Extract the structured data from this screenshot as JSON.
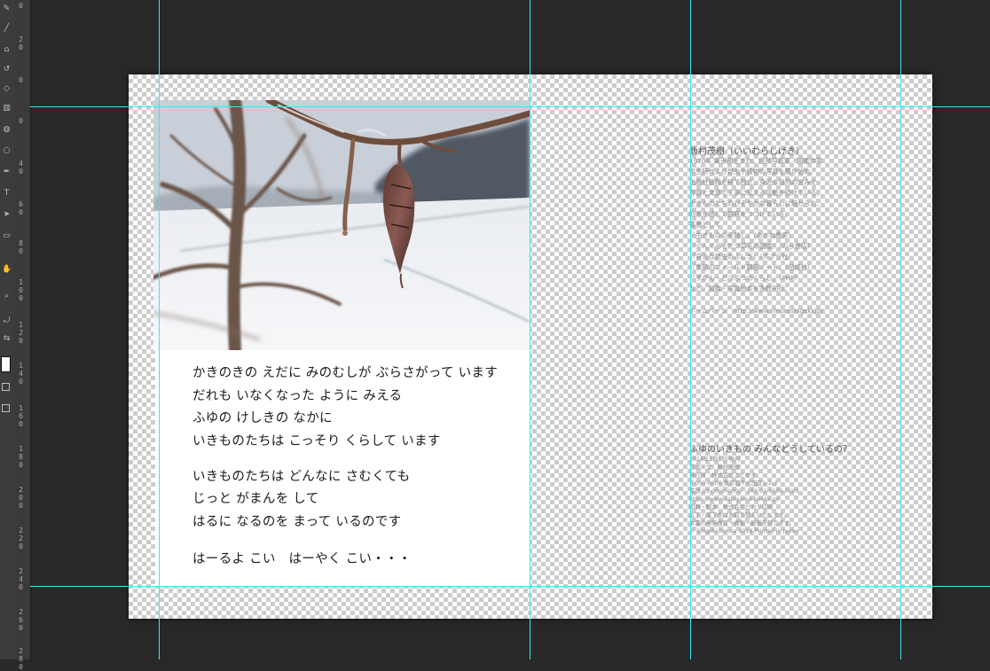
{
  "canvas": {
    "background": "#282828",
    "guide_color": "#3fe6f0"
  },
  "ruler": {
    "labels": [
      "0",
      "20",
      "0",
      "0",
      "40",
      "60",
      "80",
      "100",
      "120",
      "140",
      "160",
      "180",
      "200",
      "220",
      "240",
      "260",
      "280"
    ]
  },
  "poem": {
    "lines": [
      "かきのきの えだに みのむしが ぶらさがって います",
      "だれも いなくなった ように みえる",
      "ふゆの けしきの なかに",
      "いきものたちは こっそり くらして います",
      "いきものたちは どんなに さむくても",
      "じっと がまんを して",
      "はるに なるのを まって いるのです",
      "はーるよ こい　はーやく こい・・・"
    ]
  },
  "author": {
    "title": "飯村茂樹（いいむらしげき）",
    "lines": [
      "1970年 東京都生まれ。自然写真家／図鑑作家",
      "学生時代より昆虫や植物の写真を撮り始め、",
      "出版社勤務を経て独立。身近な自然の営みを",
      "写真と文章で丁寧に伝える活動を続けている。",
      "生きものたちのひそやかな暮らしに魅せられ、",
      "四季を通して観察をつづけている。",
      "著書として",
      "『生きものの冬越し』（あかね書房）",
      "『ぐんぐんそだつ草花の図鑑』（のら書店）",
      "『身近な昆虫のふしぎ』（ポプラ社）",
      "『季節のフィールド観察ノート』（偕成社）",
      "『ずかん・どうぶつのくらし』（PHP）",
      "など、図鑑・写真絵本を多数刊行。",
      "ホームページ　http://www.iimurashigeki.jp/"
    ]
  },
  "credits": {
    "title": "ふゆのいきもの みんなどうしているの？",
    "lines": [
      "2018年1月1日 発行",
      "写真・文　飯村茂樹",
      "発行所　株式会社さとやま",
      "〒000-0000 東京都千代田区1-2-3",
      "電話 03-0000-0000　FAX 03-0000-0001",
      "https://www.satoyama-books.jp/",
      "印刷・製本　株式会社ヒカリ印刷",
      "乱丁・落丁本はお取り替えいたします。",
      "本書の無断複写・複製・転載を禁じます。",
      "© Shigeki Iimura 2018 Printed in Japan"
    ]
  }
}
